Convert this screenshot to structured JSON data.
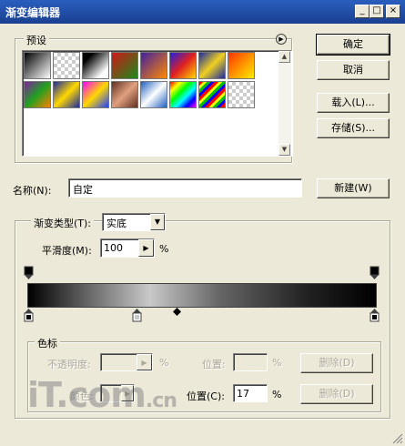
{
  "window": {
    "title": "渐变编辑器",
    "min": "_",
    "max": "□",
    "close": "×"
  },
  "presets": {
    "label": "预设",
    "menu_icon": "circle-arrow-icon"
  },
  "buttons": {
    "ok": "确定",
    "cancel": "取消",
    "load": "载入(L)...",
    "save": "存储(S)...",
    "new": "新建(W)",
    "delete_opacity": "删除(D)",
    "delete_color": "删除(D)"
  },
  "name": {
    "label": "名称(N):",
    "value": "自定"
  },
  "gradient_type": {
    "label": "渐变类型(T):",
    "value": "实底"
  },
  "smoothness": {
    "label": "平滑度(M):",
    "value": "100",
    "unit": "%"
  },
  "stops": {
    "group_label": "色标",
    "opacity_label": "不透明度:",
    "opacity_unit": "%",
    "opacity_location_label": "位置:",
    "opacity_location_unit": "%",
    "color_label": "颜色:",
    "location_label": "位置(C):",
    "location_value": "17",
    "location_unit": "%"
  },
  "watermark": {
    "main": "iT.com",
    "suffix": ".cn"
  }
}
